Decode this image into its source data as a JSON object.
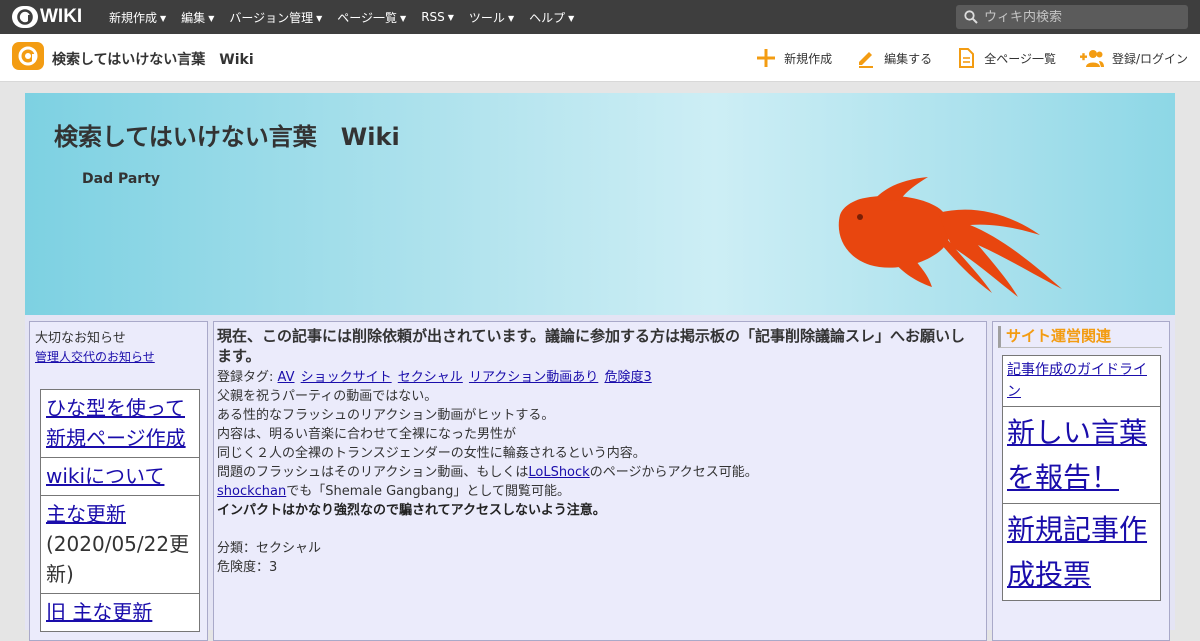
{
  "topbar": {
    "logo_text": "WIKI",
    "menu": [
      {
        "label": "新規作成"
      },
      {
        "label": "編集"
      },
      {
        "label": "バージョン管理"
      },
      {
        "label": "ページ一覧"
      },
      {
        "label": "RSS"
      },
      {
        "label": "ツール"
      },
      {
        "label": "ヘルプ"
      }
    ],
    "search_placeholder": "ウィキ内検索"
  },
  "header": {
    "site_title": "検索してはいけない言葉　Wiki",
    "actions": [
      {
        "label": "新規作成",
        "icon": "plus-icon"
      },
      {
        "label": "編集する",
        "icon": "pencil-icon"
      },
      {
        "label": "全ページ一覧",
        "icon": "document-icon"
      },
      {
        "label": "登録/ログイン",
        "icon": "user-add-icon"
      }
    ]
  },
  "banner": {
    "title": "検索してはいけない言葉　Wiki",
    "subtitle": "Dad Party"
  },
  "left": {
    "notice_title": "大切なお知らせ",
    "notice_link": "管理人交代のお知らせ",
    "nav": [
      {
        "link": "ひな型を使って新規ページ作成",
        "extra": ""
      },
      {
        "link": "wikiについて",
        "extra": ""
      },
      {
        "link": "主な更新",
        "extra": "(2020/05/22更新)"
      },
      {
        "link": "旧 主な更新",
        "extra": ""
      }
    ]
  },
  "main": {
    "notice": "現在、この記事には削除依頼が出されています。議論に参加する方は掲示板の「記事削除議論スレ」へお願いします。",
    "tags_label": "登録タグ:",
    "tags": [
      "AV",
      "ショックサイト",
      "セクシャル",
      "リアクション動画あり",
      "危険度3"
    ],
    "lines": [
      "父親を祝うパーティの動画ではない。",
      "ある性的なフラッシュのリアクション動画がヒットする。",
      "内容は、明るい音楽に合わせて全裸になった男性が",
      "同じく２人の全裸のトランスジェンダーの女性に輪姦されるという内容。"
    ],
    "line5_pre": "問題のフラッシュはそのリアクション動画、もしくは",
    "line5_link": "LoLShock",
    "line5_post": "のページからアクセス可能。",
    "line6_link": "shockchan",
    "line6_post": "でも「Shemale Gangbang」として閲覧可能。",
    "warning": "インパクトはかなり強烈なので騙されてアクセスしないよう注意。",
    "category": "分類：セクシャル",
    "danger": "危険度：3"
  },
  "right": {
    "title": "サイト運営関連",
    "links": [
      "記事作成のガイドライン",
      "新しい言葉を報告！",
      "新規記事作成投票"
    ]
  },
  "colors": {
    "accent_orange": "#f39c12",
    "link_blue": "#1a0dab",
    "fish": "#e8460f"
  }
}
